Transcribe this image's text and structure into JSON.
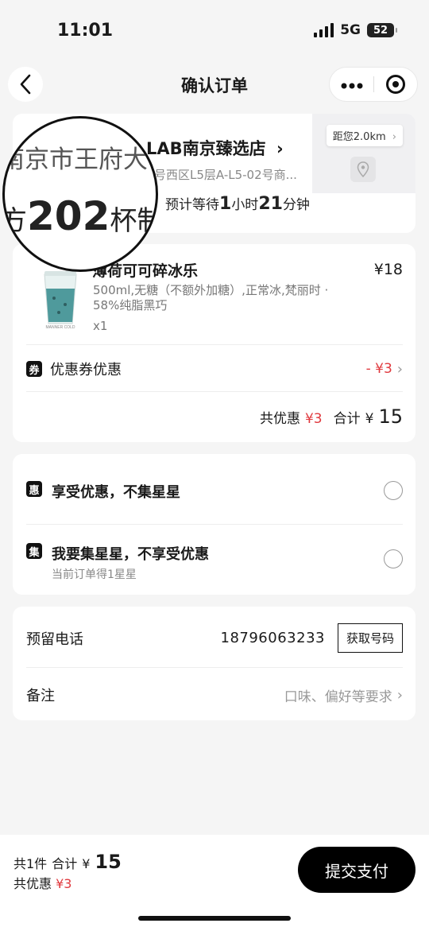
{
  "status": {
    "time": "11:01",
    "network": "5G",
    "battery": "52"
  },
  "nav": {
    "title": "确认订单"
  },
  "store": {
    "name": "LAB南京臻选店",
    "address": "号西区L5层A-L5-02号商...",
    "distance": "距您2.0km",
    "wait_prefix": "预计等待",
    "wait_hours": "1",
    "wait_hours_unit": "小时",
    "wait_minutes": "21",
    "wait_minutes_unit": "分钟"
  },
  "magnifier": {
    "line1": "南京市王府大",
    "line2_prefix": "方",
    "line2_number": "202",
    "line2_suffix": "杯制"
  },
  "product": {
    "name": "薄荷可可碎冰乐",
    "price": "¥18",
    "desc": "500ml,无糖（不额外加糖）,正常冰,梵丽时 · 58%纯脂黑巧",
    "qty": "x1",
    "img_text": "MANNER COLD"
  },
  "coupon": {
    "icon": "券",
    "label": "优惠券优惠",
    "value": "- ¥3"
  },
  "totals": {
    "discount_label": "共优惠",
    "discount": "¥3",
    "total_label": "合计",
    "currency": "¥",
    "total": "15"
  },
  "options": [
    {
      "icon": "惠",
      "title": "享受优惠，不集星星",
      "sub": ""
    },
    {
      "icon": "集",
      "title": "我要集星星，不享受优惠",
      "sub": "当前订单得1星星"
    }
  ],
  "contact": {
    "phone_label": "预留电话",
    "phone": "18796063233",
    "get_number": "获取号码",
    "remark_label": "备注",
    "remark_placeholder": "口味、偏好等要求"
  },
  "bottom": {
    "count": "共1件",
    "total_label": "合计",
    "currency": "¥",
    "total": "15",
    "discount_label": "共优惠",
    "discount": "¥3",
    "pay": "提交支付"
  }
}
